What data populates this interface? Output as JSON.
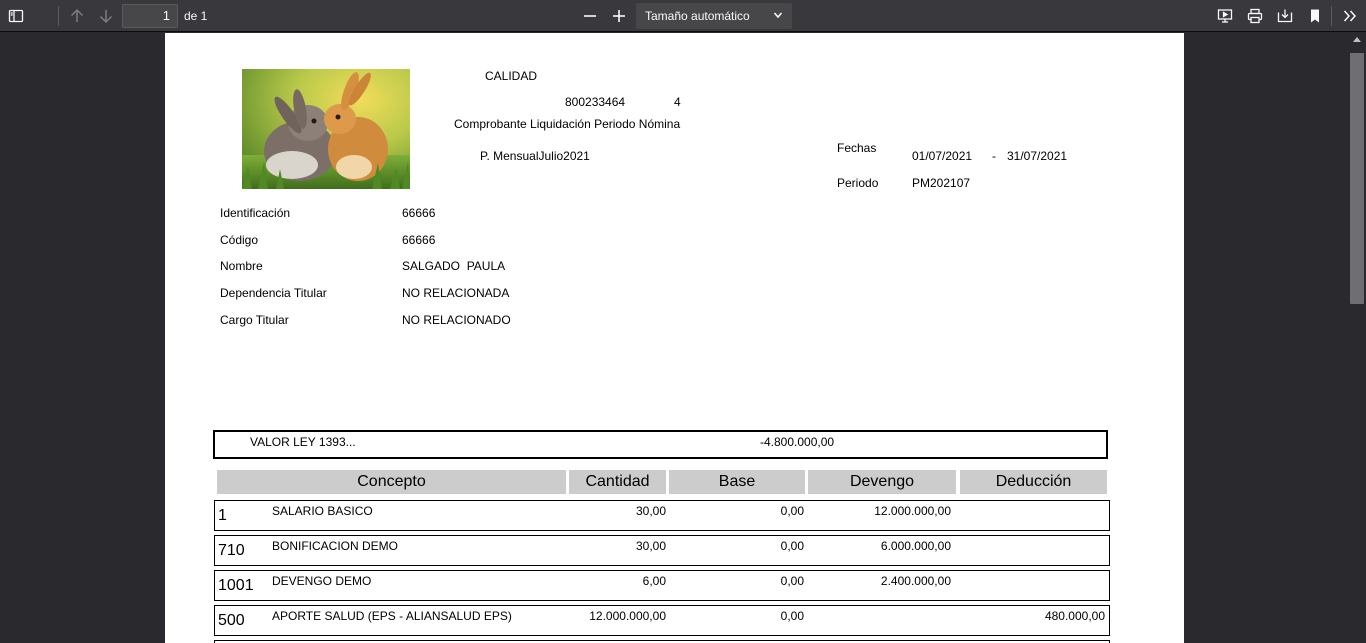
{
  "toolbar": {
    "page_number": "1",
    "page_of": "de 1",
    "zoom": "Tamaño automático"
  },
  "header": {
    "company": "CALIDAD",
    "nit": "800233464",
    "nit_dv": "4",
    "document_title": "Comprobante Liquidación Periodo Nómina",
    "period_name": "P. MensualJulio2021",
    "fechas_label": "Fechas",
    "fecha_inicio": "01/07/2021",
    "fecha_sep": "-",
    "fecha_fin": "31/07/2021",
    "periodo_label": "Periodo",
    "periodo_value": "PM202107"
  },
  "employee": {
    "fields": [
      {
        "label": "Identificación",
        "value": "66666"
      },
      {
        "label": "Código",
        "value": "66666"
      },
      {
        "label": "Nombre",
        "value": "SALGADO  PAULA"
      },
      {
        "label": "Dependencia Titular",
        "value": "NO RELACIONADA"
      },
      {
        "label": "Cargo Titular",
        "value": "NO RELACIONADO"
      }
    ]
  },
  "valor_ley": {
    "label": "VALOR LEY 1393...",
    "value": "-4.800.000,00"
  },
  "table": {
    "columns": [
      "Concepto",
      "Cantidad",
      "Base",
      "Devengo",
      "Deducción"
    ],
    "rows": [
      {
        "code": "1",
        "concept": "SALARIO BASICO",
        "cantidad": "30,00",
        "base": "0,00",
        "devengo": "12.000.000,00",
        "deduccion": ""
      },
      {
        "code": "710",
        "concept": "BONIFICACION DEMO",
        "cantidad": "30,00",
        "base": "0,00",
        "devengo": "6.000.000,00",
        "deduccion": ""
      },
      {
        "code": "1001",
        "concept": "DEVENGO DEMO",
        "cantidad": "6,00",
        "base": "0,00",
        "devengo": "2.400.000,00",
        "deduccion": ""
      },
      {
        "code": "500",
        "concept": "APORTE SALUD (EPS - ALIANSALUD EPS)",
        "cantidad": "12.000.000,00",
        "base": "0,00",
        "devengo": "",
        "deduccion": "480.000,00"
      }
    ]
  }
}
